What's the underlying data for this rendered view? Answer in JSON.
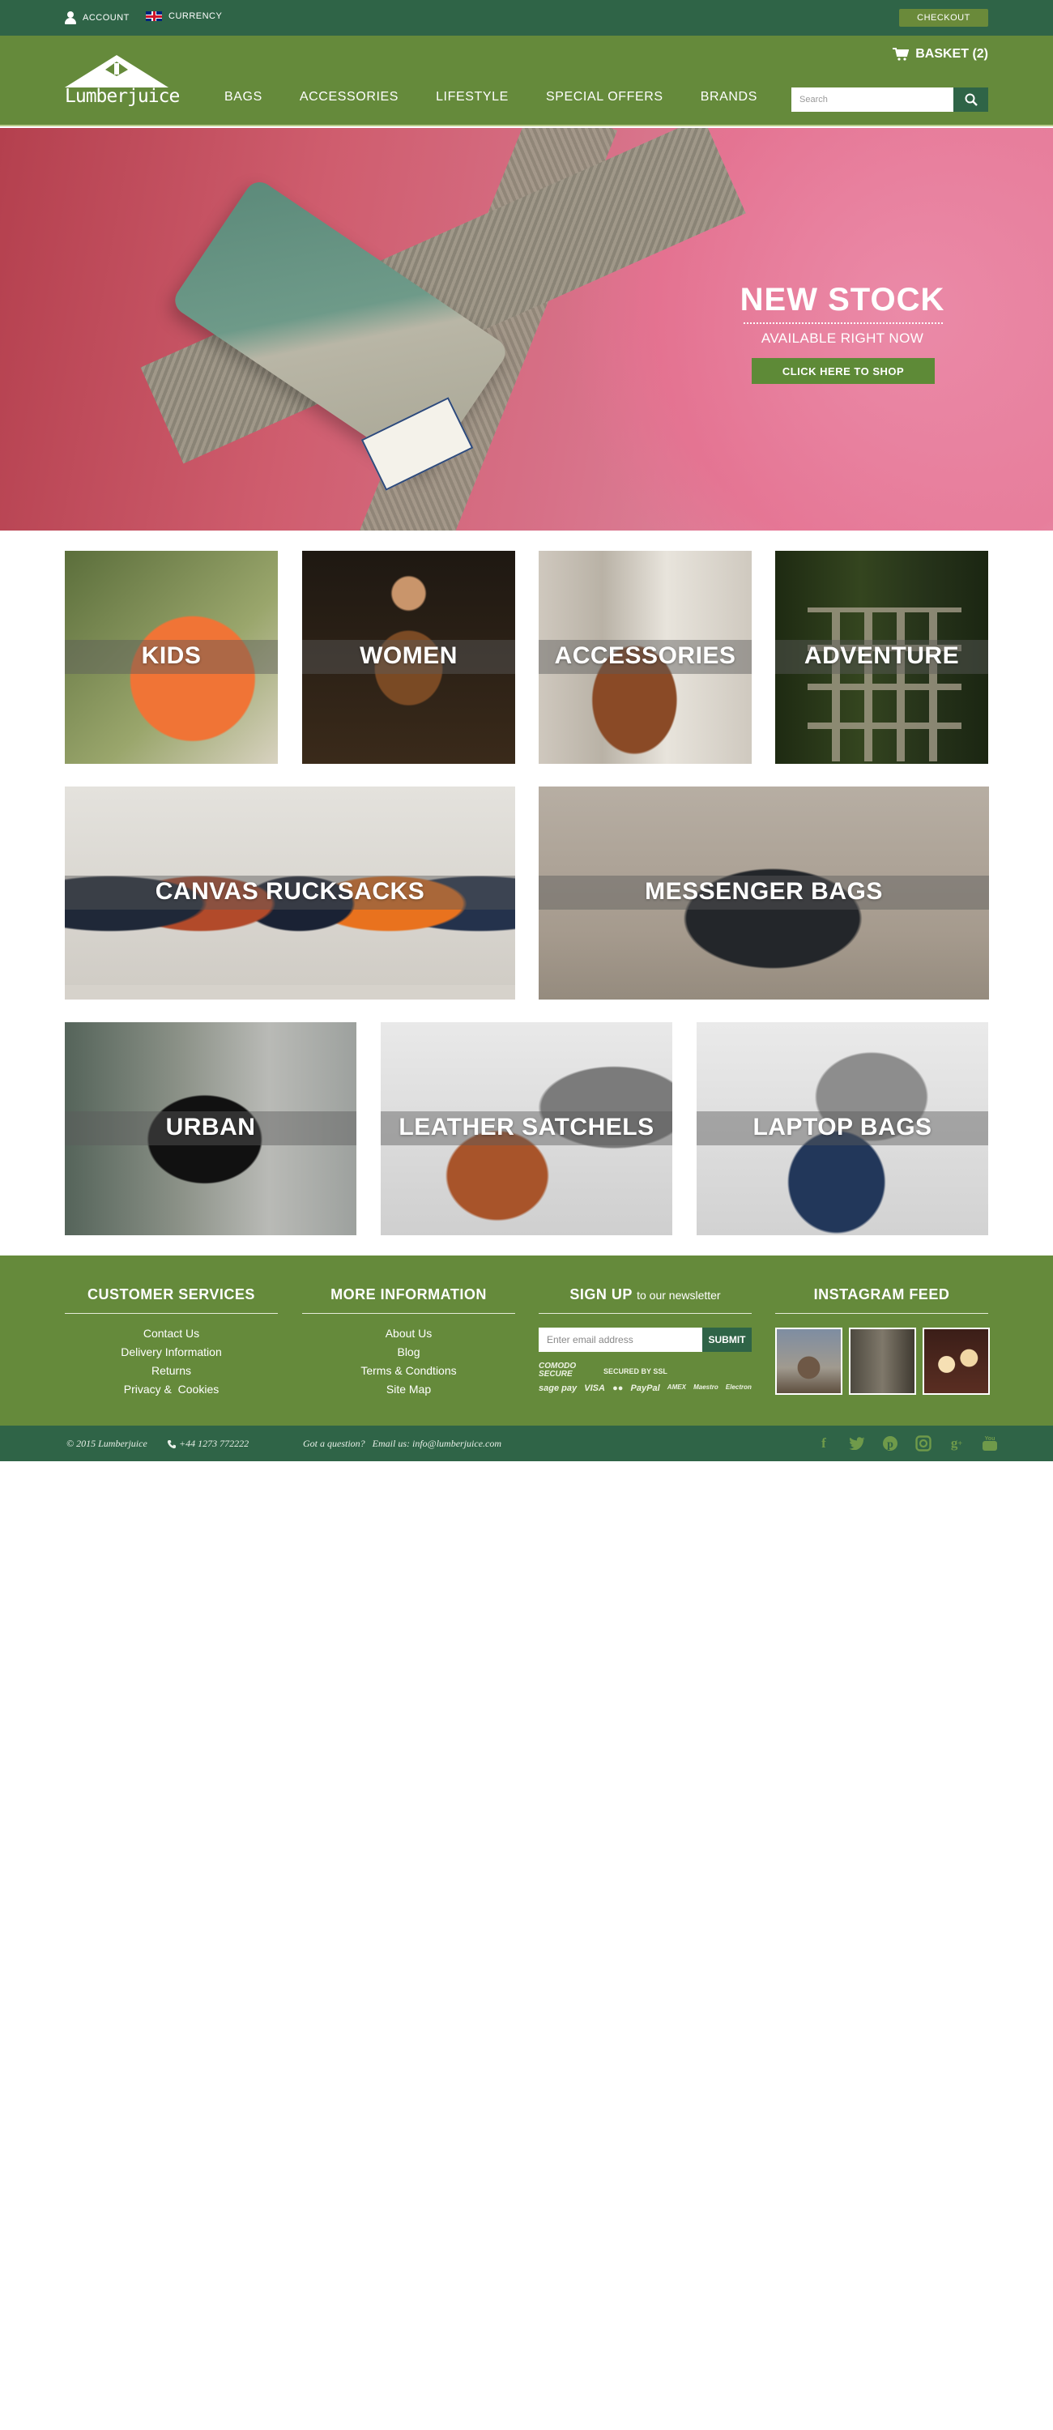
{
  "topbar": {
    "account_label": "ACCOUNT",
    "currency_label": "CURRENCY",
    "checkout_label": "CHECKOUT"
  },
  "header": {
    "logo_text": "Lumberjuice",
    "basket_label": "BASKET (2)",
    "nav": [
      "BAGS",
      "ACCESSORIES",
      "LIFESTYLE",
      "SPECIAL OFFERS",
      "BRANDS"
    ],
    "search_placeholder": "Search"
  },
  "hero": {
    "title": "NEW STOCK",
    "subtitle": "AVAILABLE RIGHT NOW",
    "cta_label": "CLICK HERE TO SHOP"
  },
  "categories": {
    "row1": [
      "KIDS",
      "WOMEN",
      "ACCESSORIES",
      "ADVENTURE"
    ],
    "row2": [
      "CANVAS RUCKSACKS",
      "MESSENGER BAGS"
    ],
    "row3": [
      "URBAN",
      "LEATHER SATCHELS",
      "LAPTOP BAGS"
    ]
  },
  "footer": {
    "customer_services": {
      "title": "CUSTOMER SERVICES",
      "links": [
        "Contact Us",
        "Delivery Information",
        "Returns",
        "Privacy &  Cookies"
      ]
    },
    "more_information": {
      "title": "MORE INFORMATION",
      "links": [
        "About Us",
        "Blog",
        "Terms & Condtions",
        "Site Map"
      ]
    },
    "signup": {
      "title": "SIGN UP",
      "title_suffix": "to our newsletter",
      "email_placeholder": "Enter email address",
      "submit_label": "SUBMIT",
      "comodo_label": "COMODO SECURE",
      "ssl_label": "SECURED BY SSL",
      "payment_methods": [
        "sage pay",
        "VISA",
        "●●",
        "PayPal",
        "AMEX",
        "Maestro",
        "Electron"
      ]
    },
    "instagram": {
      "title": "INSTAGRAM FEED"
    }
  },
  "bottombar": {
    "copyright": "© 2015 Lumberjuice",
    "phone": "+44 1273 772222",
    "question": "Got a question?   Email us: info@lumberjuice.com",
    "social_icons": [
      "facebook-icon",
      "twitter-icon",
      "pinterest-icon",
      "instagram-icon",
      "google-plus-icon",
      "youtube-icon"
    ]
  },
  "colors": {
    "dark_green": "#2f6447",
    "brand_green": "#658a3b",
    "button_green": "#5e8a37"
  }
}
